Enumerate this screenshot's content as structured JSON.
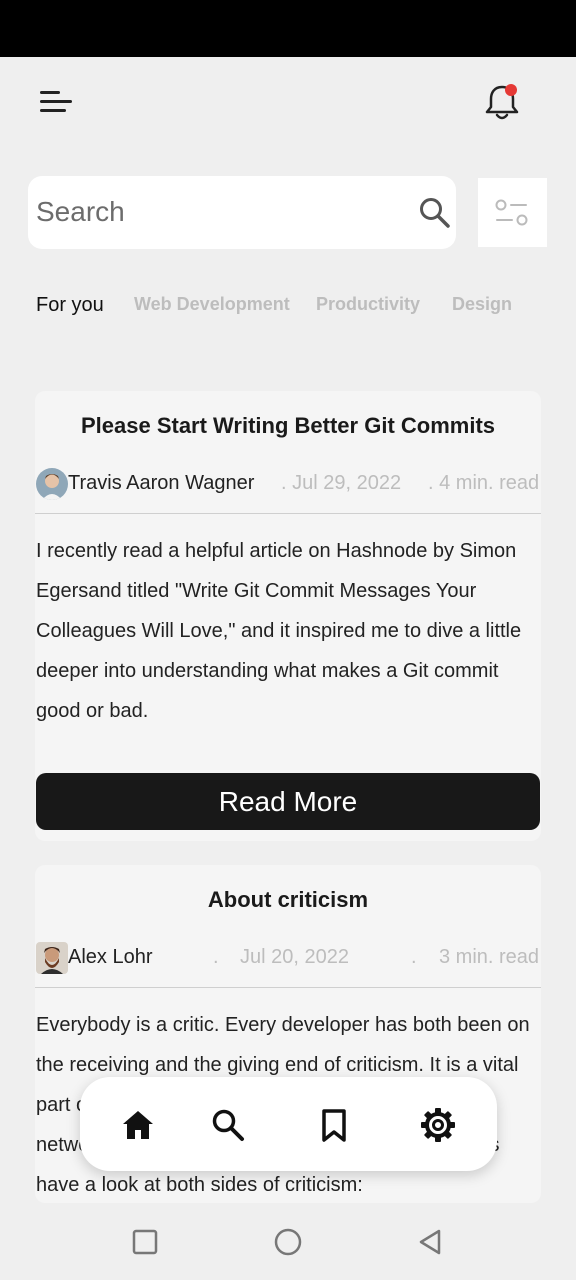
{
  "search": {
    "placeholder": "Search"
  },
  "tabs": [
    {
      "label": "For you",
      "active": true
    },
    {
      "label": "Web Development",
      "active": false
    },
    {
      "label": "Productivity",
      "active": false
    },
    {
      "label": "Design",
      "active": false
    }
  ],
  "articles": [
    {
      "title": "Please Start Writing Better Git Commits",
      "author": "Travis Aaron Wagner",
      "date": ". Jul 29, 2022",
      "read_time": ". 4 min. read",
      "excerpt": "I recently read a helpful article on Hashnode by Simon Egersand titled \"Write Git Commit Messages Your Colleagues Will Love,\" and it inspired me to dive a little deeper into understanding what makes a Git commit good or bad.",
      "cta": "Read More"
    },
    {
      "title": "About criticism",
      "author": "Alex Lohr",
      "date_dot": ".",
      "date": "Jul 20, 2022",
      "read_time_dot": ".",
      "read_time": "3 min. read",
      "excerpt": "Everybody is a critic. Every developer has both been on the receiving and the giving end of criticism. It is a vital part of our work and especially relevant on social networks where so many developers meet. So let us have a look at both sides of criticism:"
    }
  ],
  "bottom_nav": {
    "items": [
      {
        "icon": "home-icon"
      },
      {
        "icon": "search-icon"
      },
      {
        "icon": "bookmark-icon"
      },
      {
        "icon": "settings-icon"
      }
    ]
  },
  "colors": {
    "notification_dot": "#e53935",
    "button_bg": "#181818",
    "muted_text": "#bdbdbd"
  }
}
